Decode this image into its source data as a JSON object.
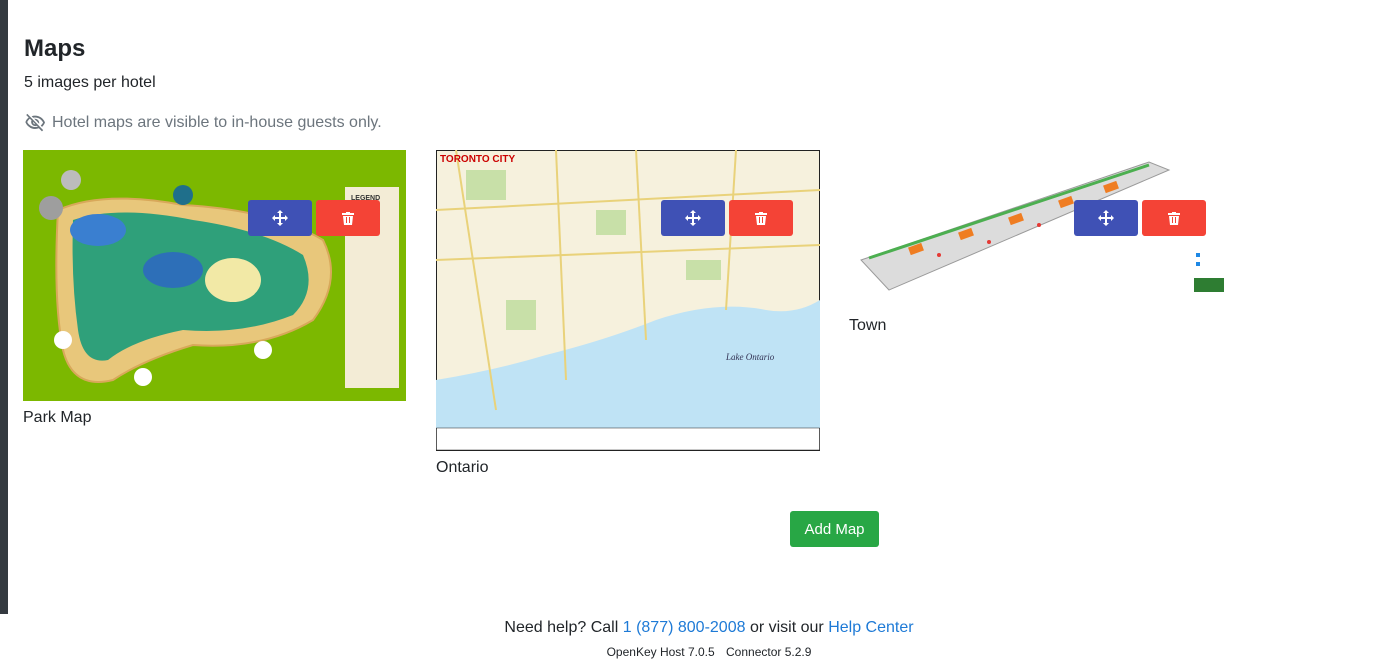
{
  "page": {
    "title": "Maps",
    "subtitle": "5 images per hotel",
    "visibility_note": "Hotel maps are visible to in-house guests only.",
    "icons": {
      "visibility": "eye-slash-icon",
      "move": "arrows-move-icon",
      "delete": "trash-icon"
    }
  },
  "maps": [
    {
      "caption": "Park Map",
      "image_text": "LEGEND"
    },
    {
      "caption": "Ontario",
      "image_text": "TORONTO CITY",
      "image_label": "Lake Ontario"
    },
    {
      "caption": "Town"
    }
  ],
  "actions": {
    "add_map_label": "Add Map"
  },
  "footer": {
    "help_prefix": "Need help? Call",
    "phone": "1 (877) 800-2008",
    "visit_text": "or visit our",
    "help_center": "Help Center",
    "host_version": "OpenKey Host 7.0.5",
    "connector_version": "Connector 5.2.9"
  },
  "colors": {
    "move_button": "#3f51b5",
    "delete_button": "#f44336",
    "add_button": "#28a745",
    "link": "#1e7ad6",
    "park_map_bg": "#7cb800"
  }
}
